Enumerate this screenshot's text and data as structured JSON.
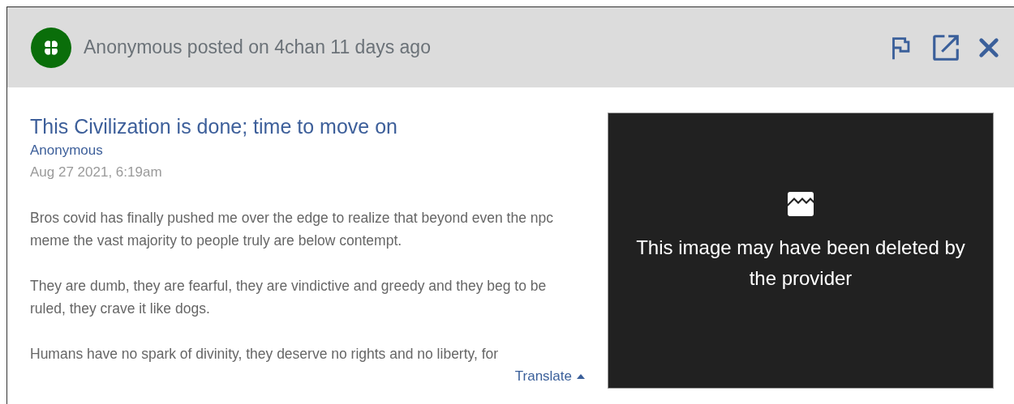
{
  "header": {
    "byline": "Anonymous posted on 4chan 11 days ago"
  },
  "post": {
    "title": "This Civilization is done; time to move on",
    "author": "Anonymous",
    "date": "Aug 27 2021, 6:19am",
    "paragraphs": [
      "Bros covid has finally pushed me over the edge to realize that beyond even the npc meme the vast majority to people truly are below contempt.",
      "They are dumb, they are fearful, they are vindictive and greedy and they beg to be ruled, they crave it like dogs.",
      "Humans have no spark of divinity, they deserve no rights and no liberty, for"
    ],
    "translate": "Translate"
  },
  "image_panel": {
    "message": "This image may have been deleted by the provider"
  }
}
